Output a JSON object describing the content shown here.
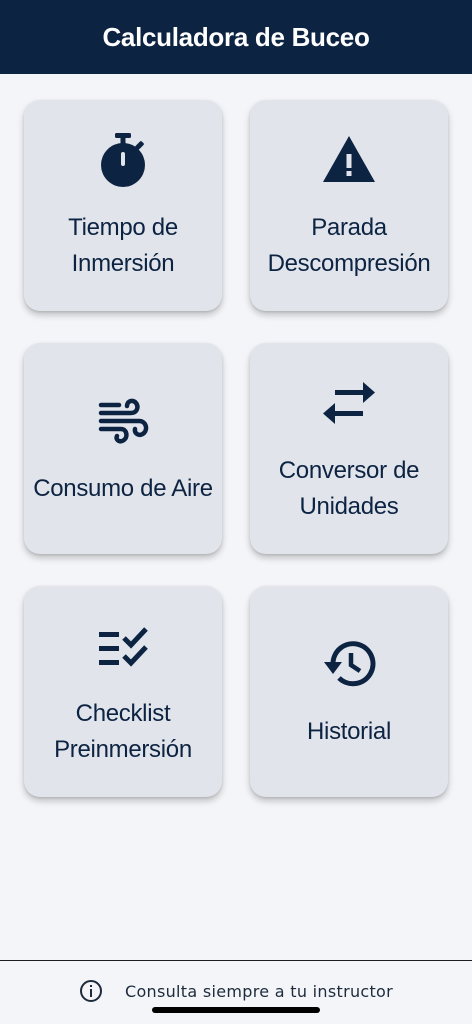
{
  "header": {
    "title": "Calculadora de Buceo"
  },
  "menu": {
    "items": [
      {
        "label": "Tiempo de\nInmersión",
        "icon": "stopwatch-icon"
      },
      {
        "label": "Parada\nDescompresión",
        "icon": "warning-icon"
      },
      {
        "label": "Consumo de Aire",
        "icon": "wind-icon"
      },
      {
        "label": "Conversor de\nUnidades",
        "icon": "swap-arrows-icon"
      },
      {
        "label": "Checklist\nPreinmersión",
        "icon": "checklist-icon"
      },
      {
        "label": "Historial",
        "icon": "history-icon"
      }
    ]
  },
  "footer": {
    "text": "Consulta siempre a tu instructor",
    "icon": "info-icon"
  },
  "colors": {
    "primary": "#0d2342",
    "card": "#e1e5eb",
    "background": "#f4f5f8"
  }
}
